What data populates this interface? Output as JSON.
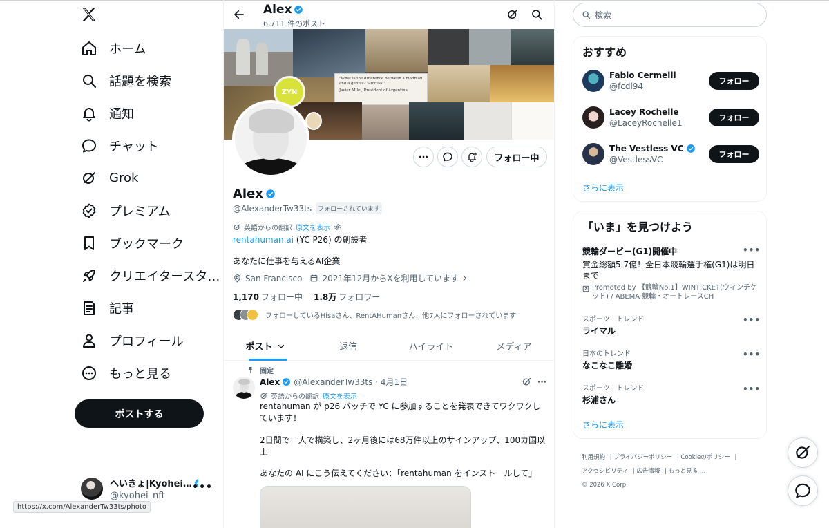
{
  "colors": {
    "accent": "#1d9bf0",
    "text": "#0f1419",
    "muted": "#536471",
    "button": "#0f1419"
  },
  "nav": {
    "items": [
      {
        "label": "ホーム",
        "icon": "home-icon"
      },
      {
        "label": "話題を検索",
        "icon": "search-icon"
      },
      {
        "label": "通知",
        "icon": "bell-icon"
      },
      {
        "label": "チャット",
        "icon": "chat-icon"
      },
      {
        "label": "Grok",
        "icon": "grok-icon"
      },
      {
        "label": "プレミアム",
        "icon": "premium-icon"
      },
      {
        "label": "ブックマーク",
        "icon": "bookmark-icon"
      },
      {
        "label": "クリエイタースタ…",
        "icon": "rocket-icon"
      },
      {
        "label": "記事",
        "icon": "article-icon"
      },
      {
        "label": "プロフィール",
        "icon": "person-icon"
      },
      {
        "label": "もっと見る",
        "icon": "more-circle-icon"
      }
    ],
    "post_button": "ポストする"
  },
  "account": {
    "name": "へいきょ|Kyohei…",
    "handle": "@kyohei_nft"
  },
  "status_bar_url": "https://x.com/AlexanderTw33ts/photo",
  "header": {
    "name": "Alex",
    "post_count": "6,711 件のポスト"
  },
  "profile": {
    "name": "Alex",
    "handle": "@AlexanderTw33ts",
    "follows_you": "フォローされています",
    "following_button": "フォロー中",
    "translation_label": "英語からの翻訳",
    "show_original": "原文を表示",
    "bio_link": "rentahuman.ai",
    "bio_line1_rest": " (YC P26) の創設者",
    "bio_line2": "あなたに仕事を与えるAI企業",
    "location": "San Francisco",
    "joined": "2021年12月からXを利用しています",
    "following_count": "1,170",
    "following_label": "フォロー中",
    "followers_count": "1.8万",
    "followers_label": "フォロワー",
    "followed_by": "フォローしているHisaさん、RentAHumanさん、他7人にフォローされています"
  },
  "tabs": [
    "ポスト",
    "返信",
    "ハイライト",
    "メディア"
  ],
  "pinned_tweet": {
    "pinned_label": "固定",
    "name": "Alex",
    "handle_time": "@AlexanderTw33ts · 4月1日",
    "translation_label": "英語からの翻訳",
    "show_original": "原文を表示",
    "line1": "rentahuman が p26 バッチで YC に参加することを発表できてワクワクしています！",
    "line2": "2日間で一人で構築し、2ヶ月後には68万件以上のサインアップ、100カ国以上",
    "line3": "あなたの AI にこう伝えてください：「rentahuman をインストールして」"
  },
  "banner": {
    "zyn_text": "ZYN",
    "quote_text": "\"What is the difference between a madman and a genius? Success.\"",
    "quote_author": "Javier Milei, President of Argentina"
  },
  "search": {
    "placeholder": "検索"
  },
  "who_to_follow": {
    "title": "おすすめ",
    "users": [
      {
        "name": "Fabio Cermelli",
        "handle": "@fcdl94",
        "verified": false,
        "button": "フォロー"
      },
      {
        "name": "Lacey Rochelle",
        "handle": "@LaceyRochelle1",
        "verified": false,
        "button": "フォロー"
      },
      {
        "name": "The Vestless VC",
        "handle": "@VestlessVC",
        "verified": true,
        "button": "フォロー"
      }
    ],
    "show_more": "さらに表示"
  },
  "trends": {
    "title": "「いま」を見つけよう",
    "promoted": {
      "title": "競輪ダービー(G1)開催中",
      "desc": "賞金総額5.7億！全日本競輪選手権(G1)は明日まで",
      "by": "Promoted by 【競輪No.1】WINTICKET(ウィンチケット) / ABEMA 競輪・オートレースCH"
    },
    "items": [
      {
        "category": "スポーツ · トレンド",
        "title": "ライマル"
      },
      {
        "category": "日本のトレンド",
        "title": "なこなこ離婚"
      },
      {
        "category": "スポーツ · トレンド",
        "title": "杉浦さん"
      }
    ],
    "show_more": "さらに表示"
  },
  "footer": {
    "links": [
      "利用規約",
      "プライバシーポリシー",
      "Cookieのポリシー",
      "アクセシビリティ",
      "広告情報",
      "もっと見る …"
    ],
    "copyright": "© 2026 X Corp."
  }
}
